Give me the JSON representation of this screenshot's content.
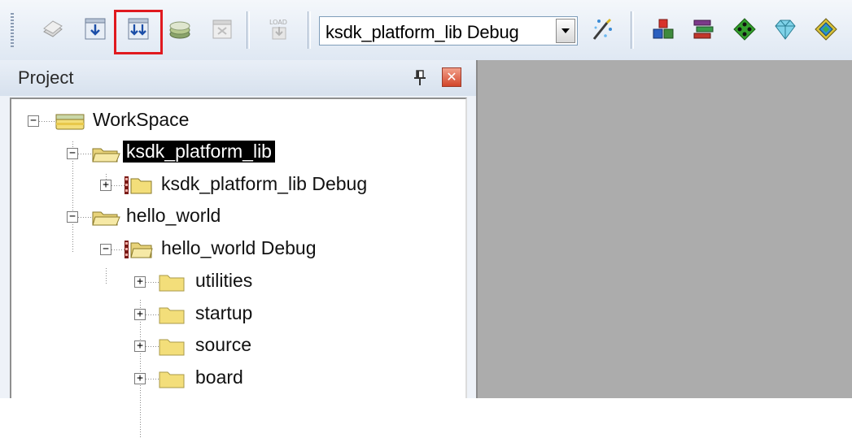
{
  "toolbar": {
    "target_value": "ksdk_platform_lib Debug",
    "buttons": [
      {
        "name": "translate-icon"
      },
      {
        "name": "build-icon"
      },
      {
        "name": "rebuild-icon"
      },
      {
        "name": "batch-build-icon"
      },
      {
        "name": "stop-build-icon"
      },
      {
        "name": "download-icon"
      },
      {
        "name": "target-options-icon"
      },
      {
        "name": "manage-components-icon"
      },
      {
        "name": "select-packs-icon"
      },
      {
        "name": "pack-installer-icon"
      },
      {
        "name": "run-time-env-icon"
      },
      {
        "name": "device-db-icon"
      }
    ],
    "highlight_color": "#e0191f"
  },
  "project_panel": {
    "title": "Project",
    "tree": [
      {
        "label": "WorkSpace",
        "expanded": true
      },
      {
        "label": "ksdk_platform_lib",
        "expanded": true,
        "selected": true
      },
      {
        "label": "ksdk_platform_lib Debug",
        "expanded": false
      },
      {
        "label": "hello_world",
        "expanded": true
      },
      {
        "label": "hello_world Debug",
        "expanded": true
      },
      {
        "label": "utilities",
        "expanded": false
      },
      {
        "label": "startup",
        "expanded": false
      },
      {
        "label": "source",
        "expanded": false
      },
      {
        "label": "board",
        "expanded": false
      }
    ]
  },
  "colors": {
    "selection_bg": "#000000",
    "editor_bg": "#acacac",
    "folder_yellow": "#f3de7a"
  }
}
